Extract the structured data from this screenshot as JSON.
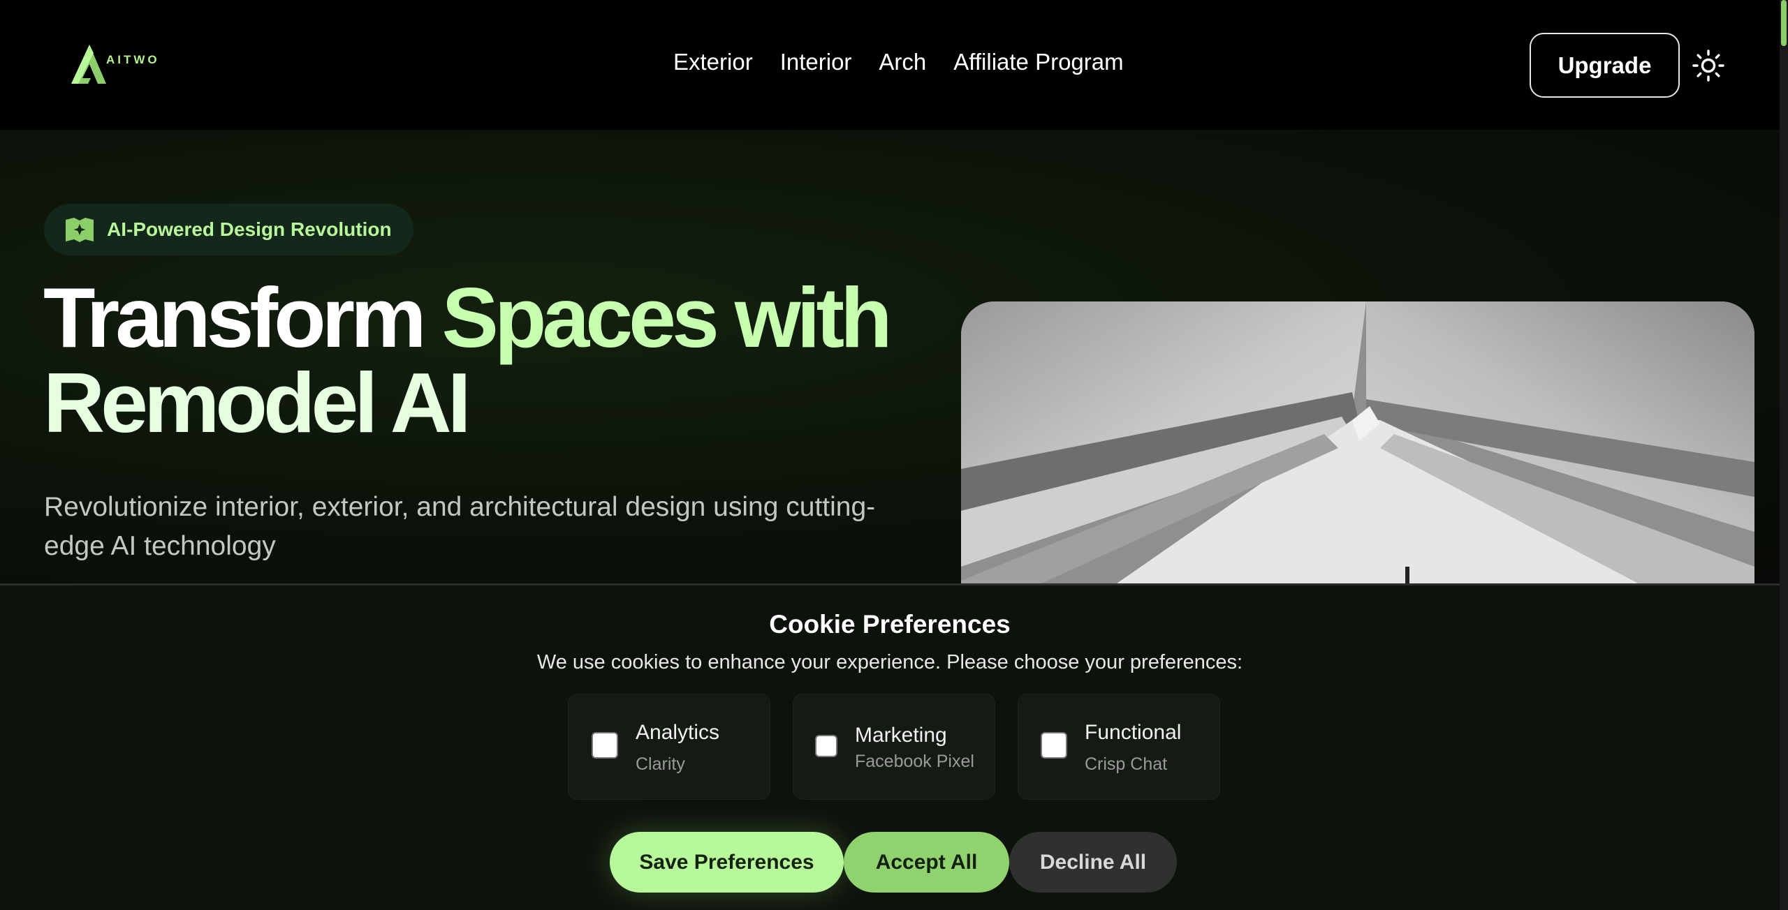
{
  "brand": {
    "name": "AITWO",
    "accent": "#b8f79a"
  },
  "nav": {
    "items": [
      "Exterior",
      "Interior",
      "Arch",
      "Affiliate Program"
    ]
  },
  "header": {
    "upgrade_label": "Upgrade",
    "theme_icon": "sun-icon"
  },
  "hero": {
    "badge": "AI-Powered Design Revolution",
    "title_w1": "Transform",
    "title_g1": "Spaces with",
    "title_l2": "Remodel AI",
    "subtitle": "Revolutionize interior, exterior, and architectural design using cutting-edge AI technology"
  },
  "cookie": {
    "title": "Cookie Preferences",
    "description": "We use cookies to enhance your experience. Please choose your preferences:",
    "options": [
      {
        "name": "Analytics",
        "provider": "Clarity",
        "checked": false
      },
      {
        "name": "Marketing",
        "provider": "Facebook Pixel",
        "checked": false
      },
      {
        "name": "Functional",
        "provider": "Crisp Chat",
        "checked": false
      }
    ],
    "save_label": "Save Preferences",
    "accept_label": "Accept All",
    "decline_label": "Decline All"
  }
}
